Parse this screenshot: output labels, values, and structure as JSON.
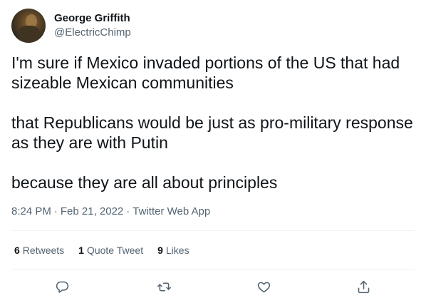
{
  "author": {
    "display_name": "George Griffith",
    "handle": "@ElectricChimp"
  },
  "tweet": {
    "paragraphs": [
      "I'm sure if Mexico invaded portions of the US that had sizeable Mexican communities",
      "that Republicans would be just as pro-military response as they are with Putin",
      "because they are all about principles"
    ],
    "time": "8:24 PM",
    "separator": "·",
    "date": "Feb 21, 2022",
    "source": "Twitter Web App"
  },
  "stats": {
    "retweets": {
      "count": "6",
      "label": "Retweets"
    },
    "quote_tweets": {
      "count": "1",
      "label": "Quote Tweet"
    },
    "likes": {
      "count": "9",
      "label": "Likes"
    }
  },
  "actions": {
    "reply_icon": "reply-icon",
    "retweet_icon": "retweet-icon",
    "like_icon": "heart-icon",
    "share_icon": "share-icon"
  },
  "colors": {
    "text_primary": "#0f1419",
    "text_secondary": "#536471",
    "divider": "#eff3f4",
    "background": "#ffffff"
  }
}
